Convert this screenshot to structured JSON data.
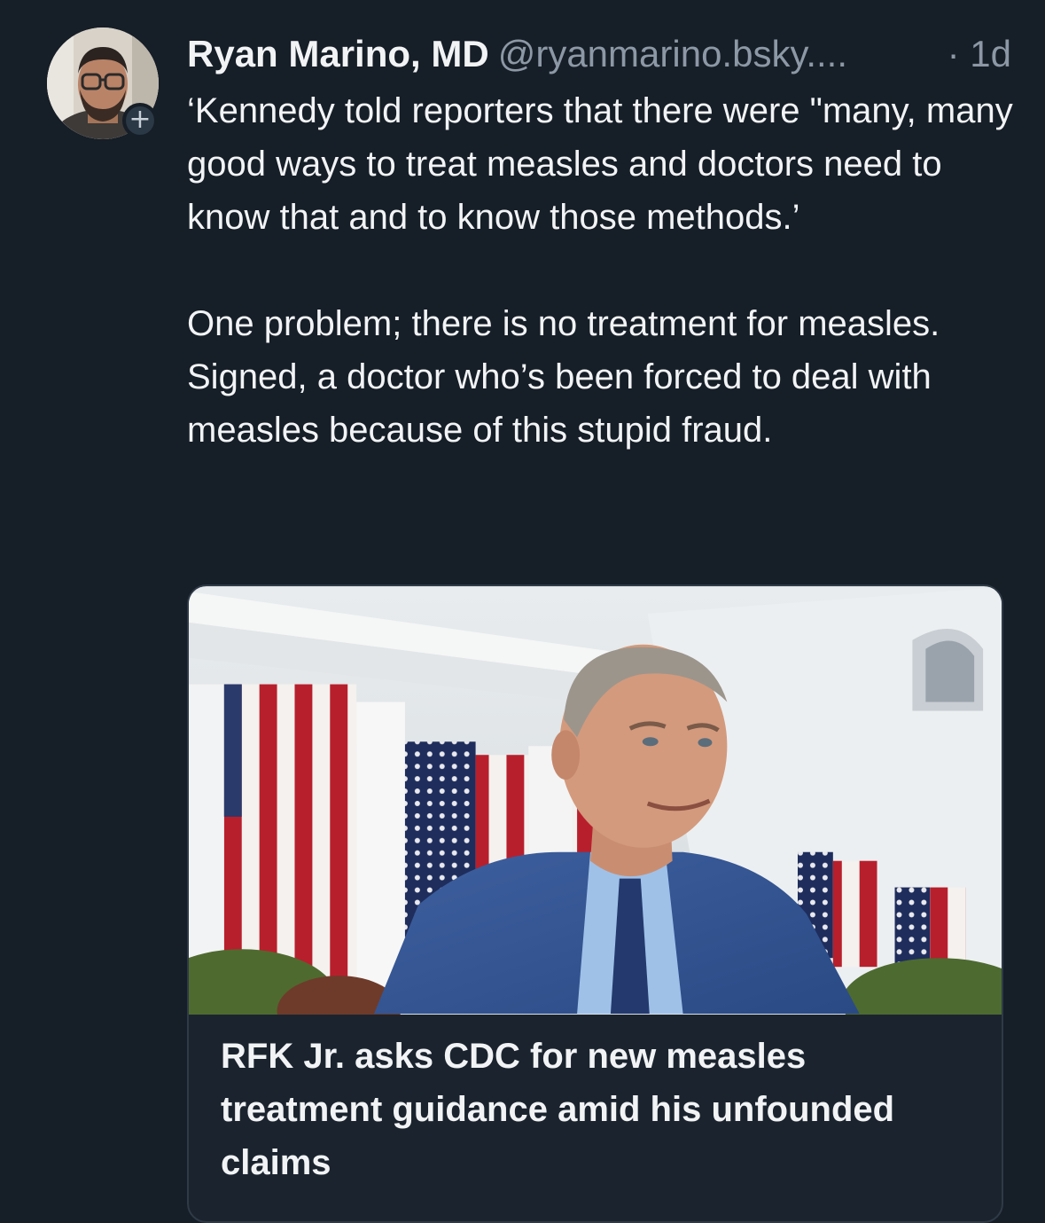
{
  "post": {
    "author": {
      "display_name": "Ryan Marino, MD",
      "handle": "@ryanmarino.bsky....",
      "follow_symbol": "+"
    },
    "timestamp": "· 1d",
    "text": "‘Kennedy told reporters that there were \"many, many good ways to treat measles and doctors need to know that and to know those methods.’\n\nOne problem; there is no treatment for measles. Signed, a doctor who’s been forced to deal with measles because of this stupid fraud.",
    "link_card": {
      "title": "RFK Jr. asks CDC for new measles treatment guidance amid his unfounded claims"
    }
  },
  "colors": {
    "background": "#161e27",
    "text_primary": "#f1f3f5",
    "text_secondary": "#8c98a5",
    "card_border": "#2e3a47"
  }
}
